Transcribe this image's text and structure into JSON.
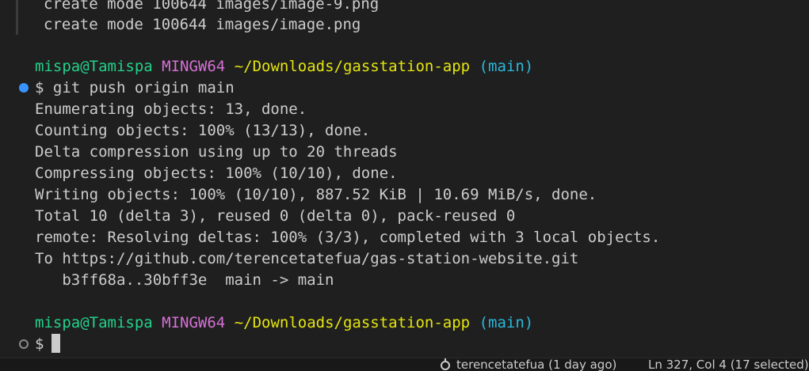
{
  "terminal": {
    "lines_top": [
      "create mode 100644 images/image-9.png",
      "create mode 100644 images/image.png"
    ],
    "prompt1": {
      "user": "mispa@Tamispa",
      "env": "MINGW64",
      "path": "~/Downloads/gasstation-app",
      "branch": "(main)"
    },
    "command": "$ git push origin main",
    "output": [
      "Enumerating objects: 13, done.",
      "Counting objects: 100% (13/13), done.",
      "Delta compression using up to 20 threads",
      "Compressing objects: 100% (10/10), done.",
      "Writing objects: 100% (10/10), 887.52 KiB | 10.69 MiB/s, done.",
      "Total 10 (delta 3), reused 0 (delta 0), pack-reused 0",
      "remote: Resolving deltas: 100% (3/3), completed with 3 local objects.",
      "To https://github.com/terencetatefua/gas-station-website.git",
      "   b3ff68a..30bff3e  main -> main"
    ],
    "prompt2": {
      "user": "mispa@Tamispa",
      "env": "MINGW64",
      "path": "~/Downloads/gasstation-app",
      "branch": "(main)"
    },
    "current_input": "$"
  },
  "statusbar": {
    "blame": "terencetatefua (1 day ago)",
    "position": "Ln 327, Col 4 (17 selected)"
  },
  "icons": {
    "success_decoration": "command-success-icon",
    "pending_decoration": "command-pending-icon",
    "blame": "git-commit-icon"
  },
  "colors": {
    "background": "#1f1f1f",
    "user": "#23d18b",
    "env": "#d670d6",
    "path": "#e5e510",
    "branch": "#29b8db"
  }
}
